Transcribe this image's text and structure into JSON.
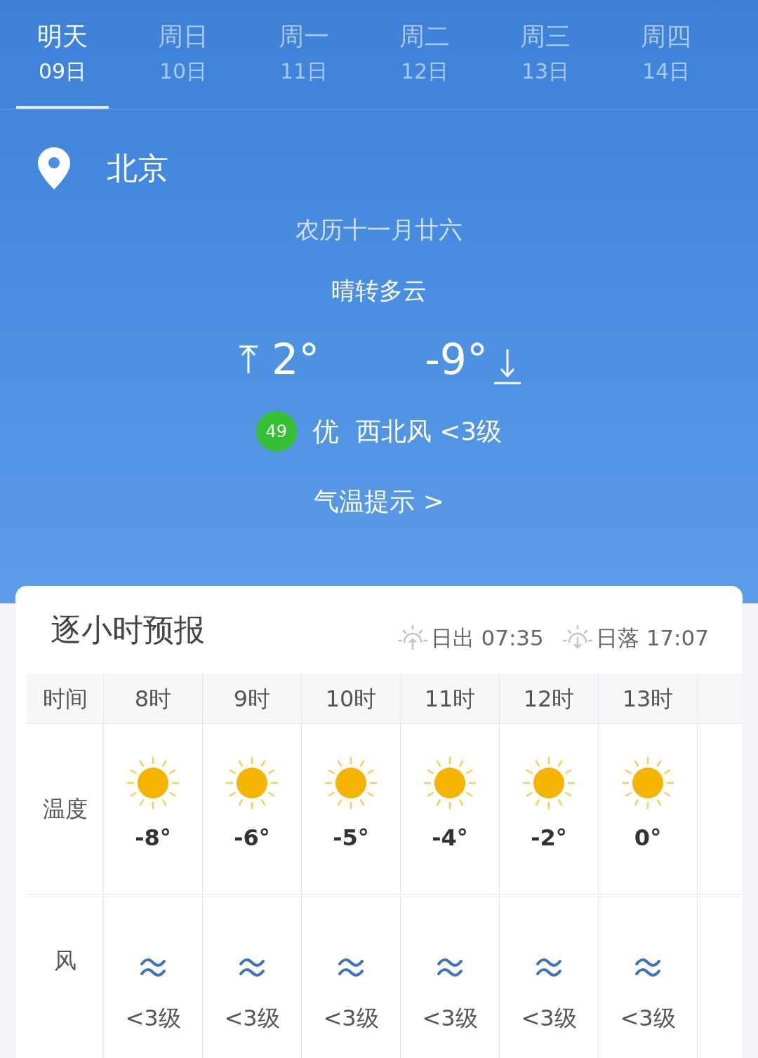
{
  "day_tabs": [
    {
      "weekday": "明天",
      "date": "09日",
      "selected": true
    },
    {
      "weekday": "周日",
      "date": "10日",
      "selected": false
    },
    {
      "weekday": "周一",
      "date": "11日",
      "selected": false
    },
    {
      "weekday": "周二",
      "date": "12日",
      "selected": false
    },
    {
      "weekday": "周三",
      "date": "13日",
      "selected": false
    },
    {
      "weekday": "周四",
      "date": "14日",
      "selected": false
    }
  ],
  "location": {
    "city": "北京"
  },
  "lunar_date": "农历十一月廿六",
  "condition": "晴转多云",
  "high": "2°",
  "low": "-9°",
  "aqi": {
    "value": "49",
    "quality": "优"
  },
  "wind": "西北风 <3级",
  "temp_tip": "气温提示 >",
  "hourly": {
    "title": "逐小时预报",
    "sunrise": "日出 07:35",
    "sunset": "日落 17:07",
    "row_labels": {
      "time": "时间",
      "temperature": "温度",
      "wind": "风"
    },
    "hours": [
      {
        "time": "8时",
        "kind": "sunny",
        "temp": "-8°",
        "wind": "<3级"
      },
      {
        "time": "9时",
        "kind": "sunny",
        "temp": "-6°",
        "wind": "<3级"
      },
      {
        "time": "10时",
        "kind": "sunny",
        "temp": "-5°",
        "wind": "<3级"
      },
      {
        "time": "11时",
        "kind": "sunny",
        "temp": "-4°",
        "wind": "<3级"
      },
      {
        "time": "12时",
        "kind": "sunny",
        "temp": "-2°",
        "wind": "<3级"
      },
      {
        "time": "13时",
        "kind": "sunny",
        "temp": "0°",
        "wind": "<3级"
      }
    ]
  }
}
